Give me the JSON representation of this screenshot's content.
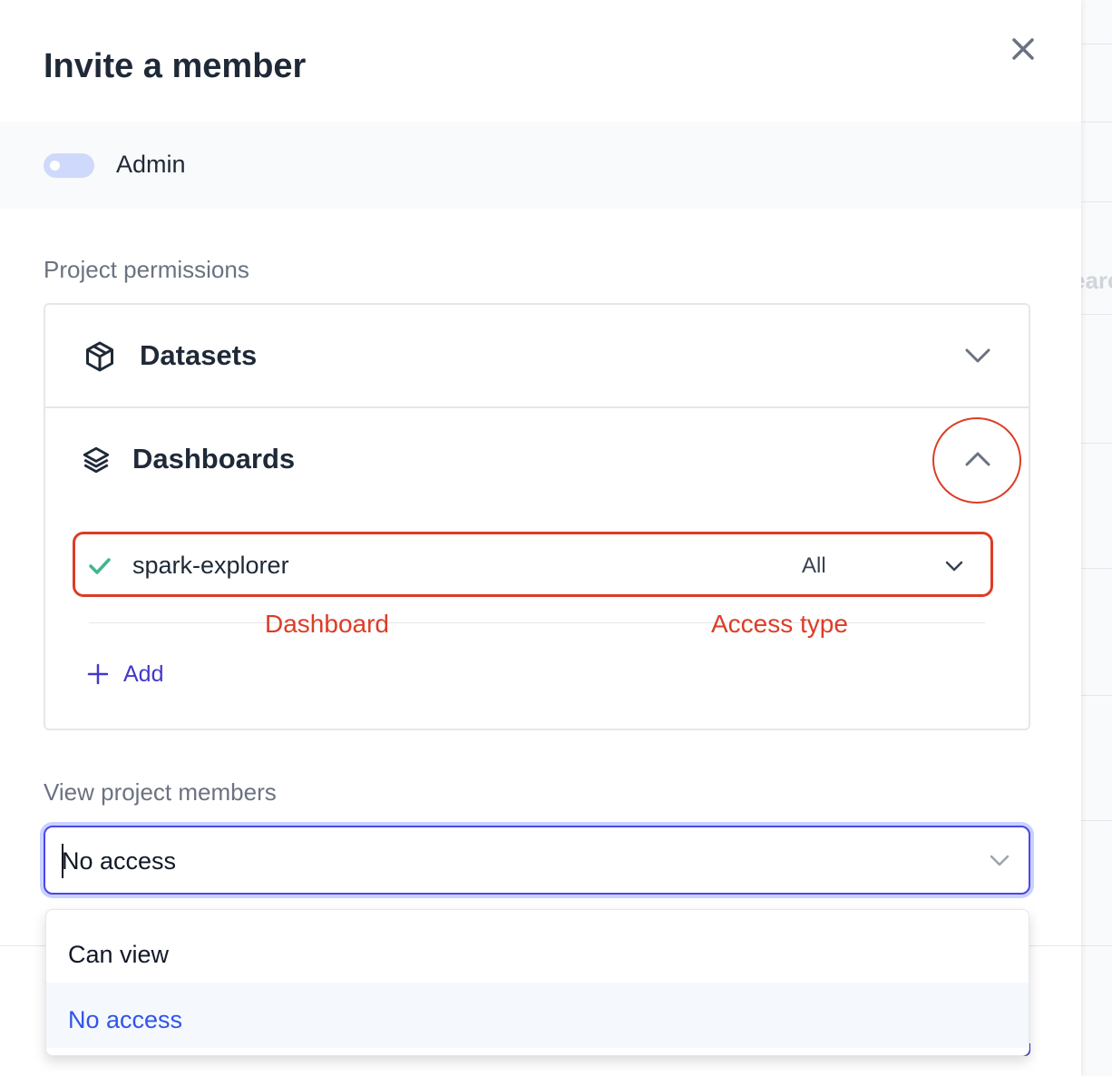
{
  "modal": {
    "title": "Invite a member",
    "admin_label": "Admin",
    "admin_enabled": false
  },
  "background": {
    "partial_text": "earc"
  },
  "permissions": {
    "label": "Project permissions",
    "sections": [
      {
        "label": "Datasets",
        "icon": "cube-icon",
        "expanded": false
      },
      {
        "label": "Dashboards",
        "icon": "layers-icon",
        "expanded": true
      }
    ],
    "dashboard_items": [
      {
        "name": "spark-explorer",
        "access": "All",
        "checked": true
      }
    ],
    "add_label": "Add"
  },
  "annotations": {
    "dashboard": "Dashboard",
    "access_type": "Access type",
    "color": "#dc3d26"
  },
  "members": {
    "label": "View project members",
    "selected": "No access",
    "options": [
      "Can view",
      "No access"
    ]
  },
  "colors": {
    "accent": "#4f46e5",
    "selected_option": "#2f54eb",
    "check": "#3fb68f"
  }
}
